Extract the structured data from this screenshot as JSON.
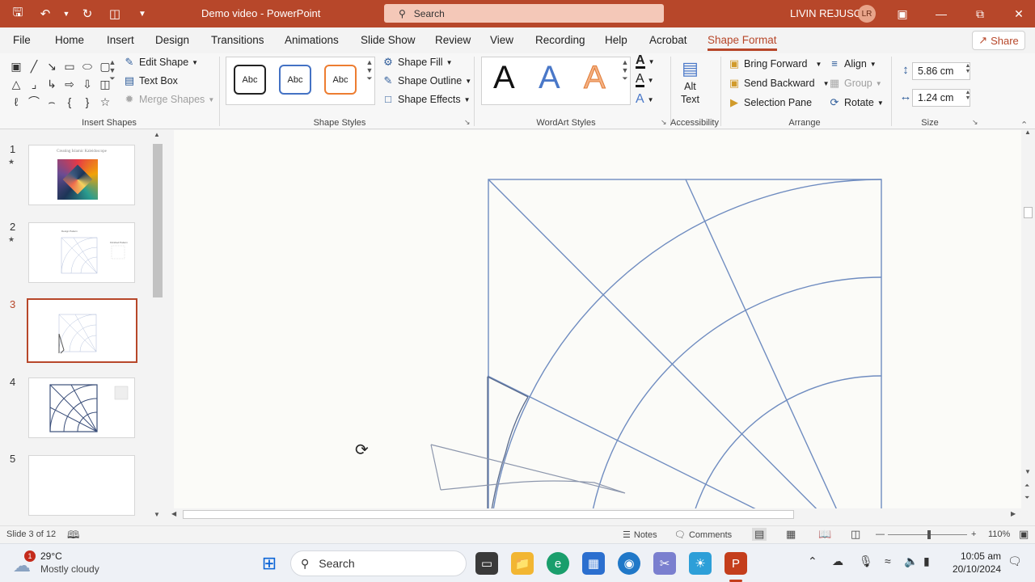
{
  "titlebar": {
    "doc_title": "Demo video  -  PowerPoint",
    "search_placeholder": "Search",
    "user_name": "LIVIN REJUSO",
    "user_initials": "LR"
  },
  "tabs": [
    "File",
    "Home",
    "Insert",
    "Design",
    "Transitions",
    "Animations",
    "Slide Show",
    "Review",
    "View",
    "Recording",
    "Help",
    "Acrobat",
    "Shape Format"
  ],
  "active_tab": "Shape Format",
  "share_label": "Share",
  "ribbon": {
    "insert_shapes": {
      "label": "Insert Shapes",
      "edit_shape": "Edit Shape",
      "text_box": "Text Box",
      "merge_shapes": "Merge Shapes"
    },
    "shape_styles": {
      "label": "Shape Styles",
      "style_sample": "Abc",
      "shape_fill": "Shape Fill",
      "shape_outline": "Shape Outline",
      "shape_effects": "Shape Effects"
    },
    "wordart_styles": {
      "label": "WordArt Styles",
      "letter": "A"
    },
    "accessibility": {
      "label": "Accessibility",
      "alt_text_line1": "Alt",
      "alt_text_line2": "Text"
    },
    "arrange": {
      "label": "Arrange",
      "bring_forward": "Bring Forward",
      "send_backward": "Send Backward",
      "selection_pane": "Selection Pane",
      "align": "Align",
      "group": "Group",
      "rotate": "Rotate"
    },
    "size": {
      "label": "Size",
      "height": "5.86 cm",
      "width": "1.24 cm"
    }
  },
  "slides": [
    {
      "number": "1",
      "has_animation": true,
      "title": "Creating Islamic Kaleidoscope"
    },
    {
      "number": "2",
      "has_animation": true,
      "caption_left": "Design Pattern",
      "caption_right": "Finished Pattern"
    },
    {
      "number": "3",
      "has_animation": false
    },
    {
      "number": "4",
      "has_animation": false
    },
    {
      "number": "5",
      "has_animation": false
    }
  ],
  "active_slide": "3",
  "statusbar": {
    "slide_info": "Slide 3 of 12",
    "notes": "Notes",
    "comments": "Comments",
    "zoom": "110%"
  },
  "taskbar": {
    "weather_temp": "29°C",
    "weather_desc": "Mostly cloudy",
    "weather_badge": "1",
    "search_label": "Search",
    "time": "10:05 am",
    "date": "20/10/2024"
  },
  "colors": {
    "accent": "#b7472a",
    "slide_line": "#6f8cc0"
  }
}
